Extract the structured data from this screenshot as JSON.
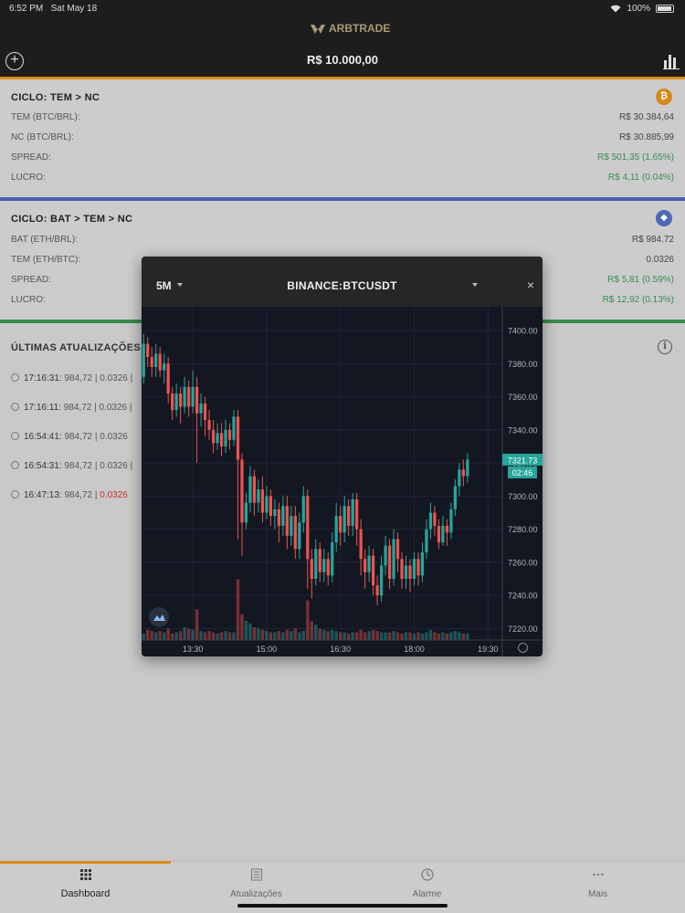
{
  "status": {
    "time": "6:52 PM",
    "date": "Sat May 18",
    "battery": "100%"
  },
  "header": {
    "logo": "ARBTRADE",
    "balance": "R$ 10.000,00"
  },
  "cycles": [
    {
      "title": "CICLO: TEM > NC",
      "coin": "₿",
      "coin_color": "#d4891a",
      "divider_color": "#4a5fb0",
      "rows": [
        {
          "label": "TEM (BTC/BRL):",
          "value": "R$ 30.384,64",
          "green": false
        },
        {
          "label": "NC (BTC/BRL):",
          "value": "R$ 30.885,99",
          "green": false
        },
        {
          "label": "SPREAD:",
          "value": "R$ 501,35 (1.65%)",
          "green": true
        },
        {
          "label": "LUCRO:",
          "value": "R$ 4,11 (0.04%)",
          "green": true
        }
      ]
    },
    {
      "title": "CICLO: BAT > TEM > NC",
      "coin": "◆",
      "coin_color": "#5068b8",
      "divider_color": "#3a8a4a",
      "rows": [
        {
          "label": "BAT (ETH/BRL):",
          "value": "R$ 984.72",
          "green": false
        },
        {
          "label": "TEM (ETH/BTC):",
          "value": "0.0326",
          "green": false
        },
        {
          "label": "SPREAD:",
          "value": "R$ 5,81 (0.59%)",
          "green": true
        },
        {
          "label": "LUCRO:",
          "value": "R$ 12,92 (0.13%)",
          "green": true
        }
      ]
    }
  ],
  "updates": {
    "title": "ÚLTIMAS ATUALIZAÇÕES",
    "items": [
      {
        "time": "17:16:31:",
        "value": "984,72 | 0.0326 |",
        "red": ""
      },
      {
        "time": "17:16:11:",
        "value": "984,72 | 0.0326 |",
        "red": ""
      },
      {
        "time": "16:54:41:",
        "value": "984,72 | 0.0326",
        "red": ""
      },
      {
        "time": "16:54:31:",
        "value": "984,72 | 0.0326 |",
        "red": ""
      },
      {
        "time": "16:47:13:",
        "value": "984,72 |",
        "red": "0.0326"
      }
    ]
  },
  "chart_modal": {
    "interval": "5M",
    "symbol": "BINANCE:BTCUSDT",
    "close": "×"
  },
  "chart_data": {
    "type": "candlestick",
    "title": "BINANCE:BTCUSDT",
    "interval": "5M",
    "yticks": [
      7400,
      7380,
      7360,
      7340,
      7320,
      7300,
      7280,
      7260,
      7240,
      7220
    ],
    "ylim": [
      7213,
      7410
    ],
    "xticks": [
      {
        "label": "13:30",
        "index": 12
      },
      {
        "label": "15:00",
        "index": 30
      },
      {
        "label": "16:30",
        "index": 48
      },
      {
        "label": "18:00",
        "index": 66
      },
      {
        "label": "19:30",
        "index": 84
      }
    ],
    "n_slots": 88,
    "last_price": "7321.73",
    "countdown": "02:46",
    "up_color": "#26a69a",
    "down_color": "#ef5350",
    "candles": [
      [
        7372,
        7392,
        7398,
        7368
      ],
      [
        7392,
        7384,
        7396,
        7378
      ],
      [
        7384,
        7378,
        7390,
        7372
      ],
      [
        7378,
        7386,
        7392,
        7372
      ],
      [
        7386,
        7376,
        7390,
        7372
      ],
      [
        7376,
        7380,
        7386,
        7368
      ],
      [
        7380,
        7362,
        7384,
        7356
      ],
      [
        7362,
        7352,
        7366,
        7346
      ],
      [
        7352,
        7362,
        7368,
        7348
      ],
      [
        7362,
        7354,
        7366,
        7344
      ],
      [
        7354,
        7366,
        7372,
        7350
      ],
      [
        7366,
        7354,
        7370,
        7348
      ],
      [
        7354,
        7366,
        7376,
        7350
      ],
      [
        7366,
        7350,
        7372,
        7320
      ],
      [
        7350,
        7356,
        7362,
        7342
      ],
      [
        7356,
        7346,
        7360,
        7336
      ],
      [
        7346,
        7340,
        7352,
        7334
      ],
      [
        7340,
        7332,
        7346,
        7326
      ],
      [
        7332,
        7338,
        7344,
        7328
      ],
      [
        7338,
        7330,
        7344,
        7324
      ],
      [
        7330,
        7340,
        7346,
        7326
      ],
      [
        7340,
        7334,
        7344,
        7328
      ],
      [
        7334,
        7348,
        7352,
        7330
      ],
      [
        7348,
        7322,
        7352,
        7274
      ],
      [
        7322,
        7284,
        7326,
        7264
      ],
      [
        7284,
        7296,
        7302,
        7280
      ],
      [
        7296,
        7312,
        7318,
        7290
      ],
      [
        7312,
        7296,
        7316,
        7288
      ],
      [
        7296,
        7304,
        7310,
        7290
      ],
      [
        7304,
        7290,
        7312,
        7284
      ],
      [
        7290,
        7300,
        7306,
        7286
      ],
      [
        7300,
        7288,
        7304,
        7282
      ],
      [
        7288,
        7292,
        7298,
        7280
      ],
      [
        7292,
        7282,
        7296,
        7272
      ],
      [
        7282,
        7294,
        7300,
        7276
      ],
      [
        7294,
        7276,
        7300,
        7268
      ],
      [
        7276,
        7288,
        7294,
        7270
      ],
      [
        7288,
        7268,
        7294,
        7262
      ],
      [
        7268,
        7284,
        7290,
        7262
      ],
      [
        7284,
        7300,
        7306,
        7278
      ],
      [
        7300,
        7262,
        7304,
        7244
      ],
      [
        7262,
        7250,
        7268,
        7238
      ],
      [
        7250,
        7268,
        7274,
        7246
      ],
      [
        7268,
        7254,
        7272,
        7248
      ],
      [
        7254,
        7262,
        7268,
        7248
      ],
      [
        7262,
        7252,
        7266,
        7246
      ],
      [
        7252,
        7272,
        7278,
        7248
      ],
      [
        7272,
        7288,
        7296,
        7266
      ],
      [
        7288,
        7278,
        7294,
        7270
      ],
      [
        7278,
        7294,
        7300,
        7272
      ],
      [
        7294,
        7282,
        7298,
        7276
      ],
      [
        7282,
        7298,
        7302,
        7276
      ],
      [
        7298,
        7280,
        7302,
        7270
      ],
      [
        7280,
        7262,
        7286,
        7252
      ],
      [
        7262,
        7254,
        7268,
        7244
      ],
      [
        7254,
        7264,
        7270,
        7248
      ],
      [
        7264,
        7246,
        7268,
        7240
      ],
      [
        7246,
        7240,
        7252,
        7234
      ],
      [
        7240,
        7258,
        7264,
        7236
      ],
      [
        7258,
        7270,
        7276,
        7252
      ],
      [
        7270,
        7250,
        7274,
        7244
      ],
      [
        7250,
        7274,
        7280,
        7246
      ],
      [
        7274,
        7262,
        7278,
        7254
      ],
      [
        7262,
        7250,
        7266,
        7244
      ],
      [
        7250,
        7258,
        7264,
        7244
      ],
      [
        7258,
        7250,
        7262,
        7242
      ],
      [
        7250,
        7262,
        7266,
        7246
      ],
      [
        7262,
        7252,
        7266,
        7246
      ],
      [
        7252,
        7266,
        7272,
        7248
      ],
      [
        7266,
        7280,
        7286,
        7262
      ],
      [
        7280,
        7290,
        7296,
        7274
      ],
      [
        7290,
        7282,
        7294,
        7276
      ],
      [
        7282,
        7272,
        7286,
        7268
      ],
      [
        7272,
        7282,
        7288,
        7270
      ],
      [
        7282,
        7278,
        7286,
        7270
      ],
      [
        7278,
        7292,
        7296,
        7274
      ],
      [
        7292,
        7306,
        7310,
        7288
      ],
      [
        7306,
        7316,
        7320,
        7300
      ],
      [
        7316,
        7312,
        7322,
        7306
      ],
      [
        7312,
        7322,
        7326,
        7308
      ]
    ],
    "volumes": [
      10,
      16,
      14,
      12,
      14,
      12,
      18,
      10,
      12,
      14,
      20,
      18,
      16,
      48,
      14,
      12,
      14,
      12,
      10,
      12,
      14,
      12,
      12,
      95,
      40,
      30,
      26,
      20,
      18,
      16,
      14,
      12,
      12,
      14,
      12,
      16,
      14,
      18,
      12,
      14,
      62,
      30,
      24,
      18,
      16,
      14,
      16,
      14,
      12,
      12,
      10,
      12,
      12,
      16,
      12,
      14,
      16,
      14,
      12,
      12,
      12,
      14,
      12,
      10,
      12,
      12,
      10,
      12,
      10,
      12,
      16,
      12,
      10,
      12,
      10,
      12,
      14,
      12,
      10,
      10
    ]
  },
  "tabs": [
    {
      "label": "Dashboard",
      "icon": "grid-icon",
      "active": true
    },
    {
      "label": "Atualizações",
      "icon": "list-icon",
      "active": false
    },
    {
      "label": "Alarme",
      "icon": "clock-icon",
      "active": false
    },
    {
      "label": "Mais",
      "icon": "more-icon",
      "active": false
    }
  ]
}
